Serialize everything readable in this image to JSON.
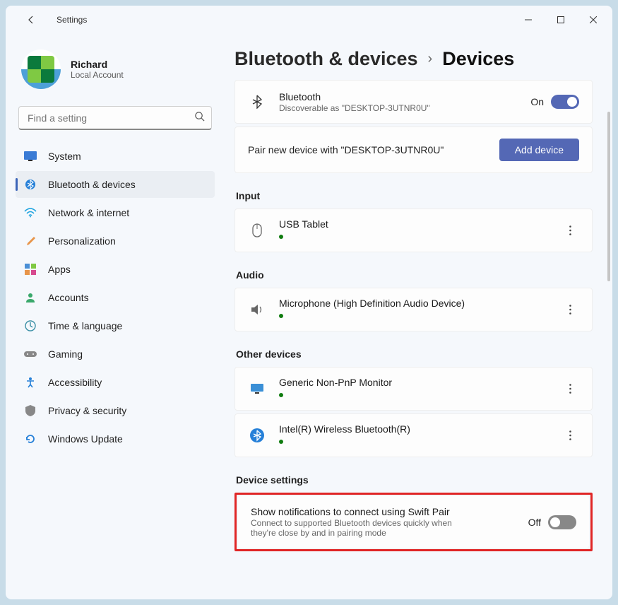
{
  "window": {
    "title": "Settings"
  },
  "user": {
    "name": "Richard",
    "type": "Local Account"
  },
  "search": {
    "placeholder": "Find a setting"
  },
  "nav": {
    "items": [
      {
        "label": "System"
      },
      {
        "label": "Bluetooth & devices"
      },
      {
        "label": "Network & internet"
      },
      {
        "label": "Personalization"
      },
      {
        "label": "Apps"
      },
      {
        "label": "Accounts"
      },
      {
        "label": "Time & language"
      },
      {
        "label": "Gaming"
      },
      {
        "label": "Accessibility"
      },
      {
        "label": "Privacy & security"
      },
      {
        "label": "Windows Update"
      }
    ]
  },
  "breadcrumb": {
    "parent": "Bluetooth & devices",
    "current": "Devices"
  },
  "bluetooth": {
    "title": "Bluetooth",
    "sub": "Discoverable as \"DESKTOP-3UTNR0U\"",
    "state_label": "On"
  },
  "pair": {
    "text": "Pair new device with \"DESKTOP-3UTNR0U\"",
    "button": "Add device"
  },
  "sections": {
    "input": {
      "header": "Input",
      "items": [
        {
          "name": "USB Tablet"
        }
      ]
    },
    "audio": {
      "header": "Audio",
      "items": [
        {
          "name": "Microphone (High Definition Audio Device)"
        }
      ]
    },
    "other": {
      "header": "Other devices",
      "items": [
        {
          "name": "Generic Non-PnP Monitor"
        },
        {
          "name": "Intel(R) Wireless Bluetooth(R)"
        }
      ]
    },
    "settings": {
      "header": "Device settings",
      "swift_pair": {
        "title": "Show notifications to connect using Swift Pair",
        "sub": "Connect to supported Bluetooth devices quickly when they're close by and in pairing mode",
        "state_label": "Off"
      }
    }
  }
}
